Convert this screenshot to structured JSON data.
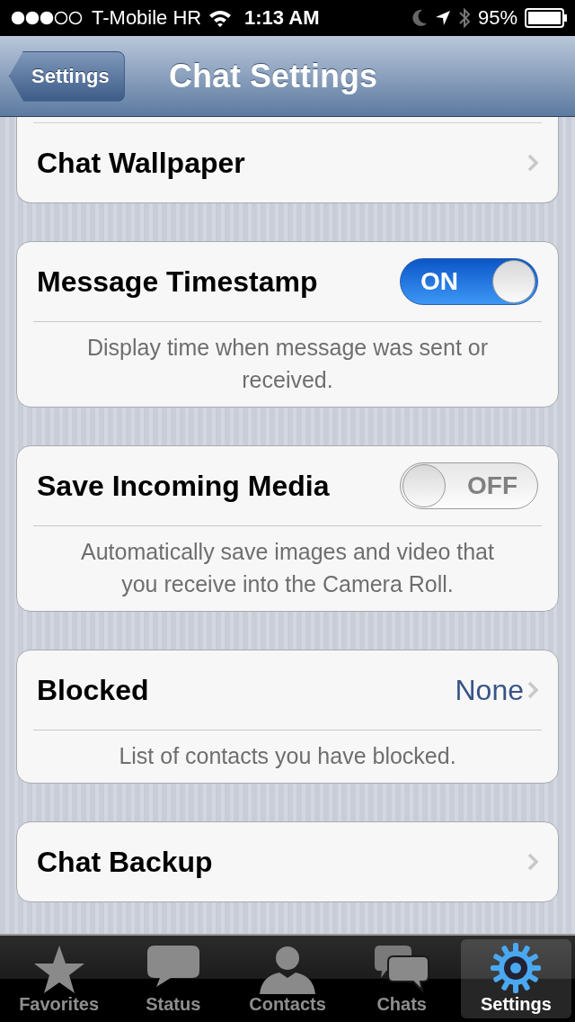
{
  "status_bar": {
    "carrier": "T-Mobile HR",
    "time": "1:13 AM",
    "battery": "95%"
  },
  "nav_bar": {
    "back": "Settings",
    "title": "Chat Settings"
  },
  "groups": [
    {
      "cut_top": true,
      "rows": [
        {
          "kind": "link",
          "label": "Chat Wallpaper"
        }
      ]
    },
    {
      "rows": [
        {
          "kind": "toggle",
          "label": "Message Timestamp",
          "on": true,
          "switch_text": "ON"
        }
      ],
      "footer": "Display time when message was sent or received."
    },
    {
      "rows": [
        {
          "kind": "toggle",
          "label": "Save Incoming Media",
          "on": false,
          "switch_text": "OFF"
        }
      ],
      "footer": "Automatically save images and video that you receive into the Camera Roll."
    },
    {
      "rows": [
        {
          "kind": "link",
          "label": "Blocked",
          "value": "None"
        }
      ],
      "footer": "List of contacts you have blocked."
    },
    {
      "rows": [
        {
          "kind": "link",
          "label": "Chat Backup"
        }
      ]
    }
  ],
  "tabs": [
    {
      "kind": "star",
      "label": "Favorites",
      "selected": false
    },
    {
      "kind": "bubble",
      "label": "Status",
      "selected": false
    },
    {
      "kind": "person",
      "label": "Contacts",
      "selected": false
    },
    {
      "kind": "bubbles",
      "label": "Chats",
      "selected": false
    },
    {
      "kind": "gear",
      "label": "Settings",
      "selected": true
    }
  ]
}
